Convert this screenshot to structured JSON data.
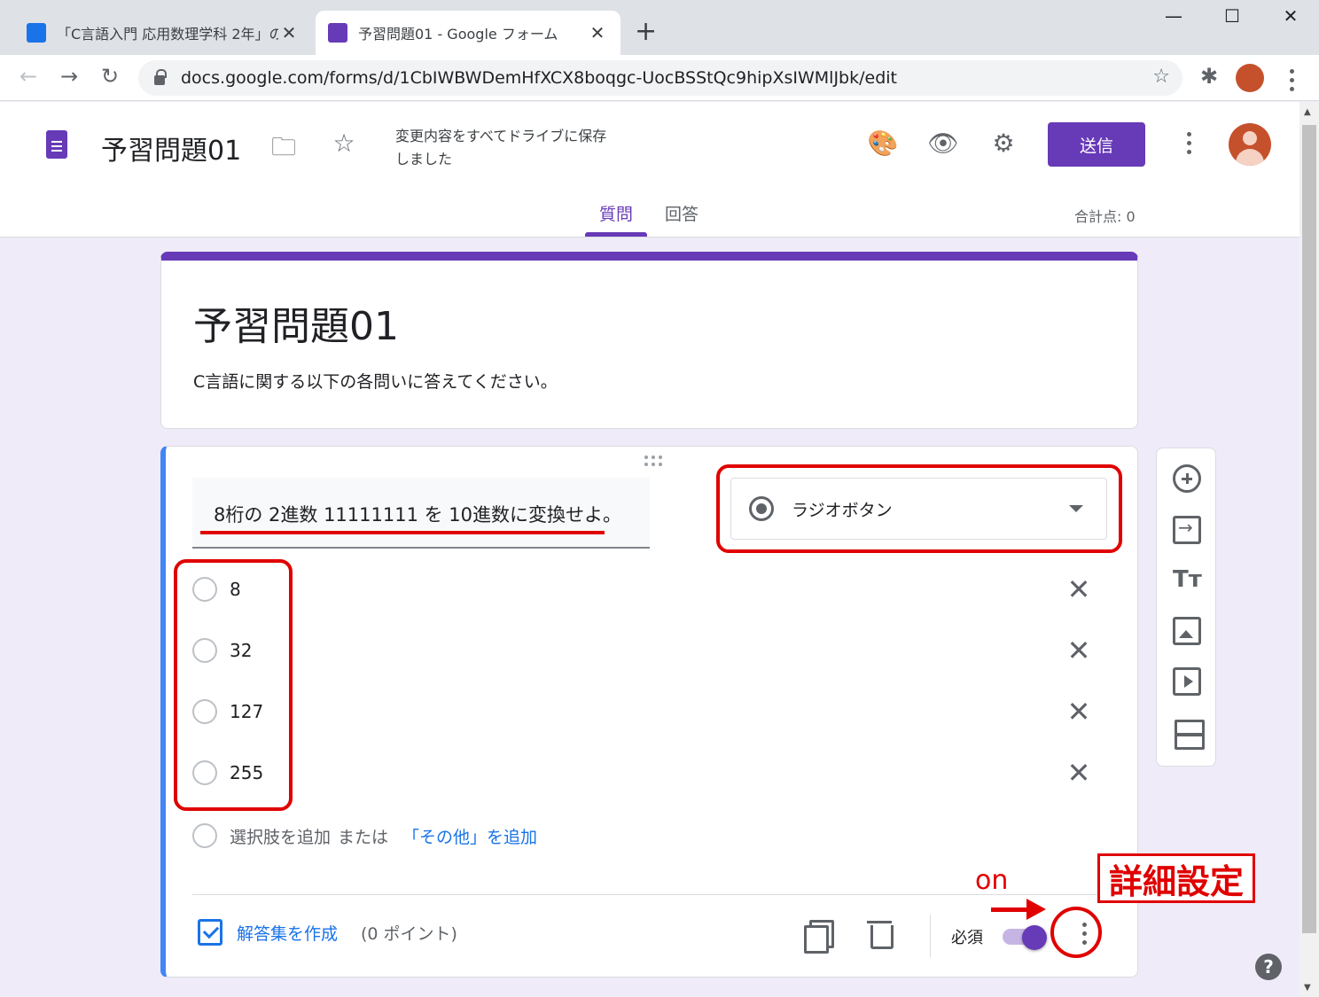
{
  "browser": {
    "tabs": [
      {
        "title": "「C言語入門 応用数理学科 2年」の",
        "favicon_color": "#1a73e8",
        "active": false
      },
      {
        "title": "予習問題01 - Google フォーム",
        "favicon_color": "#673ab7",
        "active": true
      }
    ],
    "url": "docs.google.com/forms/d/1CbIWBWDemHfXCX8boqgc-UocBSStQc9hipXsIWMlJbk/edit"
  },
  "header": {
    "doc_title": "予習問題01",
    "save_status": "変更内容をすべてドライブに保存しました",
    "send_label": "送信",
    "tabs": [
      {
        "label": "質問",
        "active": true
      },
      {
        "label": "回答",
        "active": false
      }
    ],
    "total_points": "合計点: 0"
  },
  "form": {
    "title": "予習問題01",
    "description": "C言語に関する以下の各問いに答えてください。"
  },
  "question": {
    "text": "8桁の 2進数 11111111 を 10進数に変換せよ。",
    "type": "ラジオボタン",
    "options": [
      "8",
      "32",
      "127",
      "255"
    ],
    "add_option": "選択肢を追加",
    "or_text": "または",
    "add_other": "「その他」を追加",
    "answer_key": "解答集を作成",
    "points": "(0 ポイント)",
    "required_label": "必須",
    "required": true
  },
  "annotations": {
    "on_label": "on",
    "detail_label": "詳細設定",
    "color": "#e00000"
  },
  "colors": {
    "accent": "#673ab7",
    "link": "#1a73e8",
    "question_border": "#4285f4",
    "background": "#f0ebf8"
  }
}
